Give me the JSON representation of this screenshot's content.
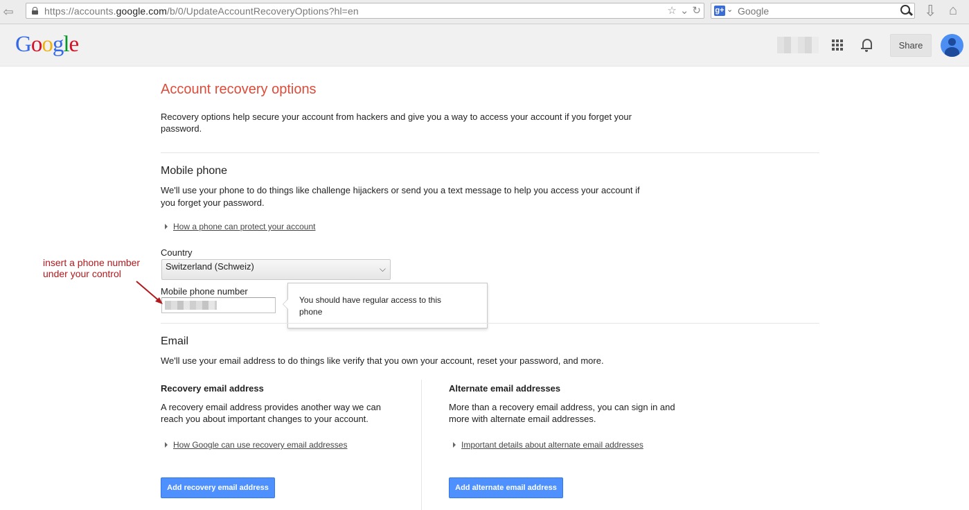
{
  "browser": {
    "url_prefix": "https://accounts.",
    "url_host": "google.com",
    "url_path": "/b/0/UpdateAccountRecoveryOptions?hl=en",
    "search_engine_badge": "g+",
    "search_placeholder": "Google",
    "url_star": "☆",
    "url_dropdown": "⌄",
    "url_reload": "↻"
  },
  "header": {
    "logo_letters": [
      "G",
      "o",
      "o",
      "g",
      "l",
      "e"
    ],
    "share_label": "Share"
  },
  "page": {
    "title": "Account recovery options",
    "intro": "Recovery options help secure your account from hackers and give you a way to access your account if you forget your password."
  },
  "mobile": {
    "title": "Mobile phone",
    "description": "We'll use your phone to do things like challenge hijackers or send you a text message to help you access your account if you forget your password.",
    "help_link": "How a phone can protect your account",
    "country_label": "Country",
    "country_value": "Switzerland (Schweiz)",
    "phone_label": "Mobile phone number",
    "tooltip": "You should have regular access to this phone"
  },
  "annotation": {
    "line1": "insert a phone number",
    "line2": "under your control",
    "color": "#b0191d"
  },
  "email": {
    "title": "Email",
    "description": "We'll use your email address to do things like verify that you own your account, reset your password, and more.",
    "recovery": {
      "heading": "Recovery email address",
      "description": "A recovery email address provides another way we can reach you about important changes to your account.",
      "help_link": "How Google can use recovery email addresses",
      "button": "Add recovery email address"
    },
    "alternate": {
      "heading": "Alternate email addresses",
      "description": "More than a recovery email address, you can sign in and more with alternate email addresses.",
      "help_link": "Important details about alternate email addresses",
      "button": "Add alternate email address"
    }
  },
  "colors": {
    "title_red": "#dd4b39",
    "button_blue": "#4d90fe"
  },
  "icons": [
    "back-icon",
    "lock-icon",
    "star-icon",
    "reload-icon",
    "search-icon",
    "download-icon",
    "home-icon",
    "apps-icon",
    "bell-icon",
    "avatar",
    "chevron-down-icon"
  ]
}
